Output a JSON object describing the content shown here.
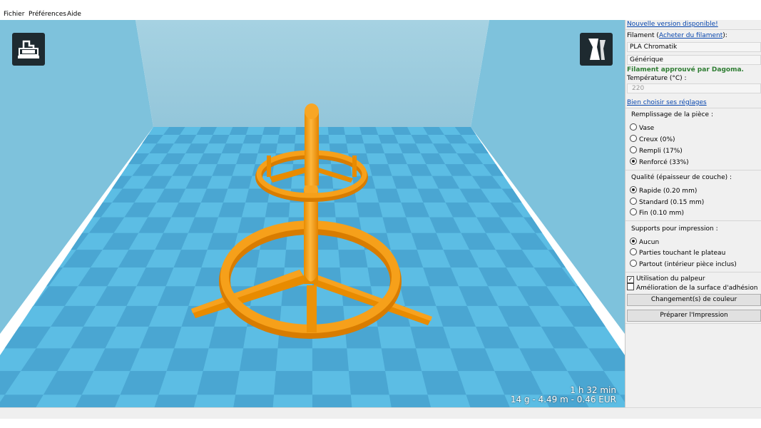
{
  "menubar": {
    "items": [
      "Fichier",
      "Préférences",
      "Aide"
    ]
  },
  "viewport": {
    "print_time": "1 h 32 min",
    "print_stats": "14 g - 4.49 m - 0.46 EUR",
    "load_icon": "load-model-icon",
    "view_icon": "view-mode-icon",
    "model_color": "#f39c12",
    "plate_color": "#56b8e0"
  },
  "panel": {
    "update_link": "Nouvelle version disponible!",
    "filament_prefix": "Filament (",
    "filament_link": "Acheter du filament",
    "filament_suffix": "):",
    "filament_value": "PLA Chromatik",
    "brand_value": "Générique",
    "approved_text": "Filament approuvé par Dagoma.",
    "temperature_label": "Température (°C) :",
    "temperature_value": "220",
    "settings_link": "Bien choisir ses réglages",
    "infill": {
      "title": "Remplissage de la pièce :",
      "options": [
        "Vase",
        "Creux (0%)",
        "Rempli (17%)",
        "Renforcé (33%)"
      ],
      "selected": "Renforcé (33%)"
    },
    "quality": {
      "title": "Qualité (épaisseur de couche) :",
      "options": [
        "Rapide (0.20 mm)",
        "Standard (0.15 mm)",
        "Fin (0.10 mm)"
      ],
      "selected": "Rapide (0.20 mm)"
    },
    "supports": {
      "title": "Supports pour impression :",
      "options": [
        "Aucun",
        "Parties touchant le plateau",
        "Partout (intérieur pièce inclus)"
      ],
      "selected": "Aucun"
    },
    "checkboxes": [
      {
        "label": "Utilisation du palpeur",
        "checked": true
      },
      {
        "label": "Amélioration de la surface d'adhésion",
        "checked": false
      }
    ],
    "color_change_button": "Changement(s) de couleur",
    "prepare_button": "Préparer l'Impression"
  }
}
